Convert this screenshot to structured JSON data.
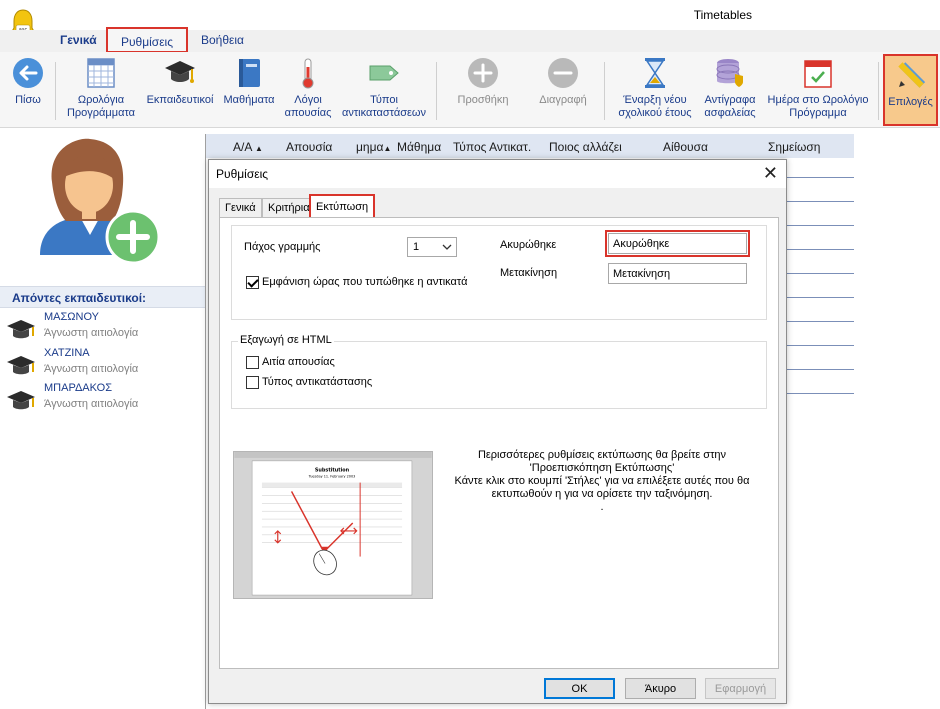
{
  "window": {
    "title": "Timetables"
  },
  "menu": {
    "items": [
      "Γενικά",
      "Ρυθμίσεις",
      "Βοήθεια"
    ]
  },
  "ribbon": {
    "back": "Πίσω",
    "timetables": [
      "Ωρολόγια",
      "Προγράμματα"
    ],
    "teachers": "Εκπαιδευτικοί",
    "subjects": "Μαθήματα",
    "absence_reasons": [
      "Λόγοι",
      "απουσίας"
    ],
    "substitution_types": [
      "Τύποι",
      "αντικαταστάσεων"
    ],
    "add": "Προσθήκη",
    "delete": "Διαγραφή",
    "new_year": [
      "Έναρξη νέου",
      "σχολικού έτους"
    ],
    "backups": [
      "Αντίγραφα",
      "ασφαλείας"
    ],
    "day_in_timetable": [
      "Ημέρα στο Ωρολόγιο",
      "Πρόγραμμα"
    ],
    "options": "Επιλογές"
  },
  "left": {
    "absent_header": "Απόντες εκπαιδευτικοί:",
    "absent": [
      {
        "name": "ΜΑΣΩΝΟΥ",
        "reason": "Άγνωστη αιτιολογία"
      },
      {
        "name": "ΧΑΤΖΙΝΑ",
        "reason": "Άγνωστη αιτιολογία"
      },
      {
        "name": "ΜΠΑΡΔΑΚΟΣ",
        "reason": "Άγνωστη αιτιολογία"
      }
    ]
  },
  "grid": {
    "columns": [
      "Α/Α",
      "Απουσία",
      "μημα",
      "Μάθημα",
      "Τύπος Αντικατ.",
      "Ποιος αλλάζει",
      "Αίθουσα",
      "Σημείωση"
    ]
  },
  "dialog": {
    "title": "Ρυθμίσεις",
    "tabs": [
      "Γενικά",
      "Κριτήρια",
      "Εκτύπωση"
    ],
    "line_thickness_label": "Πάχος γραμμής",
    "line_thickness_value": "1",
    "show_print_time_label": "Εμφάνιση ώρας που τυπώθηκε η αντικατά",
    "show_print_time_checked": true,
    "cancelled_label": "Ακυρώθηκε",
    "cancelled_value": "Ακυρώθηκε",
    "moved_label": "Μετακίνηση",
    "moved_value": "Μετακίνηση",
    "html_export_title": "Εξαγωγή σε HTML",
    "absence_cause_label": "Αιτία απουσίας",
    "substitution_type_label": "Τύπος αντικατάστασης",
    "preview": {
      "title": "Substitution",
      "date": "Tuesday 11. February 2003"
    },
    "info_lines": [
      "Περισσότερες ρυθμίσεις εκτύπωσης θα βρείτε στην",
      "'Προεπισκόπηση Εκτύπωσης'",
      "Κάντε κλικ στο κουμπί 'Στήλες' για να επιλέξετε αυτές που θα",
      "εκτυπωθούν η για να ορίσετε την ταξινόμηση.",
      "."
    ],
    "ok": "OK",
    "cancel": "Άκυρο",
    "apply": "Εφαρμογή"
  }
}
